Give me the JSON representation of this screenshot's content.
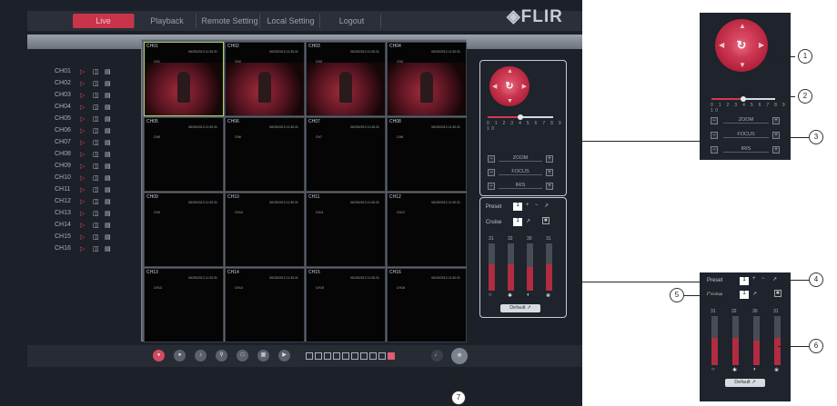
{
  "tabs": [
    {
      "label": "Live",
      "active": true
    },
    {
      "label": "Playback"
    },
    {
      "label": "Remote Setting"
    },
    {
      "label": "Local Setting"
    },
    {
      "label": "Logout"
    }
  ],
  "logo": "FLIR",
  "channels": [
    "CH01",
    "CH02",
    "CH03",
    "CH04",
    "CH05",
    "CH06",
    "CH07",
    "CH08",
    "CH09",
    "CH10",
    "CH11",
    "CH12",
    "CH13",
    "CH14",
    "CH15",
    "CH16"
  ],
  "cells": [
    {
      "name": "CH01",
      "ts": "06/25/2013 11:30:31",
      "sub": "CH1"
    },
    {
      "name": "CH02",
      "ts": "06/25/2013 11:30:31",
      "sub": "CH2"
    },
    {
      "name": "CH03",
      "ts": "06/25/2013 11:30:31",
      "sub": "CH3"
    },
    {
      "name": "CH04",
      "ts": "06/25/2013 11:30:31",
      "sub": "CH4"
    },
    {
      "name": "CH05",
      "ts": "06/25/2013 11:30:31",
      "sub": "CH5"
    },
    {
      "name": "CH06",
      "ts": "06/25/2013 11:30:31",
      "sub": "CH6"
    },
    {
      "name": "CH07",
      "ts": "06/25/2013 11:30:31",
      "sub": "CH7"
    },
    {
      "name": "CH08",
      "ts": "06/25/2013 11:30:31",
      "sub": "CH8"
    },
    {
      "name": "CH09",
      "ts": "06/25/2013 11:30:31",
      "sub": "CH9"
    },
    {
      "name": "CH10",
      "ts": "06/25/2013 11:30:31",
      "sub": "CH10"
    },
    {
      "name": "CH11",
      "ts": "06/25/2013 11:30:31",
      "sub": "CH11"
    },
    {
      "name": "CH12",
      "ts": "06/25/2013 11:30:31",
      "sub": "CH12"
    },
    {
      "name": "CH13",
      "ts": "06/25/2013 11:30:31",
      "sub": "CH13"
    },
    {
      "name": "CH14",
      "ts": "06/25/2013 11:30:31",
      "sub": "CH14"
    },
    {
      "name": "CH15",
      "ts": "06/25/2013 11:30:31",
      "sub": "CH15"
    },
    {
      "name": "CH16",
      "ts": "06/25/2013 11:30:31",
      "sub": "CH16"
    }
  ],
  "ptz": {
    "zoom": "ZOOM",
    "focus": "FOCUS",
    "iris": "IRIS",
    "scale": "0 1 2 3 4 5 6 7 8 9 10",
    "speed_level": 0.5,
    "preset": "Preset",
    "cruise": "Cruise",
    "preset_val": "1",
    "cruise_val": "1",
    "default": "Default"
  },
  "image": {
    "brightness": "31",
    "contrast": "32",
    "saturation": "30",
    "hue": "31",
    "levels": [
      0.55,
      0.55,
      0.5,
      0.55
    ]
  },
  "callouts": [
    "1",
    "2",
    "3",
    "4",
    "5",
    "6",
    "7"
  ],
  "colors": {
    "accent": "#c9344a",
    "background": "#1b2029",
    "selected": "#a7d36a"
  },
  "icons": [
    "record-icon",
    "snapshot-icon",
    "audio-icon",
    "zoom-icon",
    "fullscreen-icon",
    "layout-icon",
    "ptz-icon"
  ]
}
